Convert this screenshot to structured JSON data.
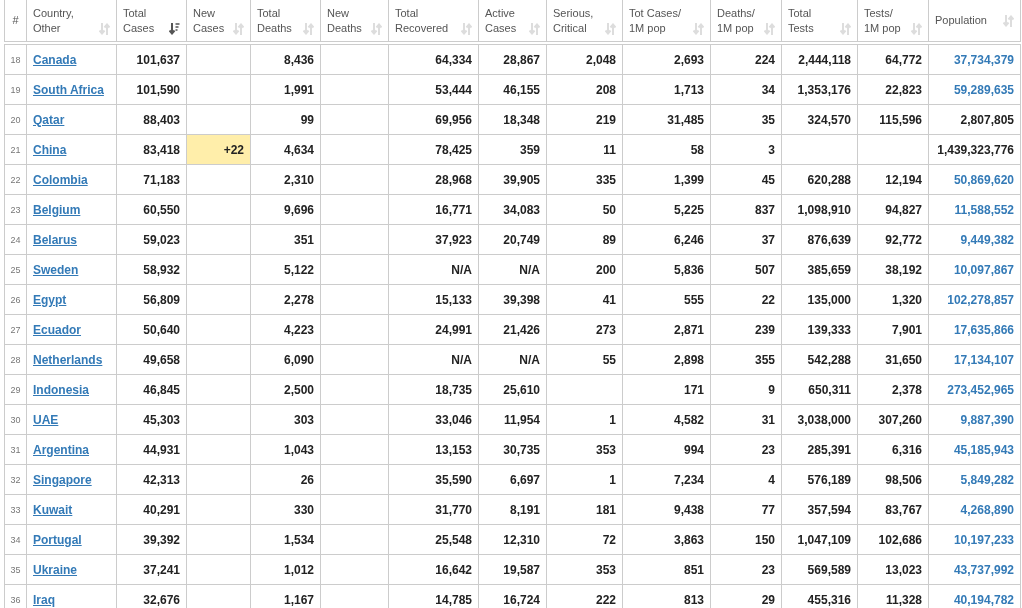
{
  "table": {
    "columns": [
      {
        "lines": [
          "#"
        ]
      },
      {
        "lines": [
          "Country,",
          "Other"
        ],
        "sorted": false
      },
      {
        "lines": [
          "Total",
          "Cases"
        ],
        "sorted": true
      },
      {
        "lines": [
          "New",
          "Cases"
        ],
        "sorted": false
      },
      {
        "lines": [
          "Total",
          "Deaths"
        ],
        "sorted": false
      },
      {
        "lines": [
          "New",
          "Deaths"
        ],
        "sorted": false
      },
      {
        "lines": [
          "Total",
          "Recovered"
        ],
        "sorted": false
      },
      {
        "lines": [
          "Active",
          "Cases"
        ],
        "sorted": false
      },
      {
        "lines": [
          "Serious,",
          "Critical"
        ],
        "sorted": false
      },
      {
        "lines": [
          "Tot Cases/",
          "1M pop"
        ],
        "sorted": false
      },
      {
        "lines": [
          "Deaths/",
          "1M pop"
        ],
        "sorted": false
      },
      {
        "lines": [
          "Total",
          "Tests"
        ],
        "sorted": false
      },
      {
        "lines": [
          "Tests/",
          "1M pop"
        ],
        "sorted": false
      },
      {
        "lines": [
          "Population"
        ],
        "sorted": false
      }
    ],
    "rows": [
      {
        "rank": "18",
        "country": "Canada",
        "total_cases": "101,637",
        "total_deaths": "8,436",
        "total_recovered": "64,334",
        "active_cases": "28,867",
        "serious_critical": "2,048",
        "cases_per_1m": "2,693",
        "deaths_per_1m": "224",
        "total_tests": "2,444,118",
        "tests_per_1m": "64,772",
        "population": "37,734,379",
        "new_highlight": false,
        "population_link": true
      },
      {
        "rank": "19",
        "country": "South Africa",
        "total_cases": "101,590",
        "total_deaths": "1,991",
        "total_recovered": "53,444",
        "active_cases": "46,155",
        "serious_critical": "208",
        "cases_per_1m": "1,713",
        "deaths_per_1m": "34",
        "total_tests": "1,353,176",
        "tests_per_1m": "22,823",
        "population": "59,289,635",
        "new_highlight": false,
        "population_link": true
      },
      {
        "rank": "20",
        "country": "Qatar",
        "total_cases": "88,403",
        "total_deaths": "99",
        "total_recovered": "69,956",
        "active_cases": "18,348",
        "serious_critical": "219",
        "cases_per_1m": "31,485",
        "deaths_per_1m": "35",
        "total_tests": "324,570",
        "tests_per_1m": "115,596",
        "population": "2,807,805",
        "new_highlight": false,
        "population_link": false
      },
      {
        "rank": "21",
        "country": "China",
        "total_cases": "83,418",
        "new_cases": "+22",
        "total_deaths": "4,634",
        "total_recovered": "78,425",
        "active_cases": "359",
        "serious_critical": "11",
        "cases_per_1m": "58",
        "deaths_per_1m": "3",
        "population": "1,439,323,776",
        "new_highlight": true,
        "population_link": false
      },
      {
        "rank": "22",
        "country": "Colombia",
        "total_cases": "71,183",
        "total_deaths": "2,310",
        "total_recovered": "28,968",
        "active_cases": "39,905",
        "serious_critical": "335",
        "cases_per_1m": "1,399",
        "deaths_per_1m": "45",
        "total_tests": "620,288",
        "tests_per_1m": "12,194",
        "population": "50,869,620",
        "new_highlight": false,
        "population_link": true
      },
      {
        "rank": "23",
        "country": "Belgium",
        "total_cases": "60,550",
        "total_deaths": "9,696",
        "total_recovered": "16,771",
        "active_cases": "34,083",
        "serious_critical": "50",
        "cases_per_1m": "5,225",
        "deaths_per_1m": "837",
        "total_tests": "1,098,910",
        "tests_per_1m": "94,827",
        "population": "11,588,552",
        "new_highlight": false,
        "population_link": true
      },
      {
        "rank": "24",
        "country": "Belarus",
        "total_cases": "59,023",
        "total_deaths": "351",
        "total_recovered": "37,923",
        "active_cases": "20,749",
        "serious_critical": "89",
        "cases_per_1m": "6,246",
        "deaths_per_1m": "37",
        "total_tests": "876,639",
        "tests_per_1m": "92,772",
        "population": "9,449,382",
        "new_highlight": false,
        "population_link": true
      },
      {
        "rank": "25",
        "country": "Sweden",
        "total_cases": "58,932",
        "total_deaths": "5,122",
        "total_recovered": "N/A",
        "active_cases": "N/A",
        "serious_critical": "200",
        "cases_per_1m": "5,836",
        "deaths_per_1m": "507",
        "total_tests": "385,659",
        "tests_per_1m": "38,192",
        "population": "10,097,867",
        "new_highlight": false,
        "population_link": true
      },
      {
        "rank": "26",
        "country": "Egypt",
        "total_cases": "56,809",
        "total_deaths": "2,278",
        "total_recovered": "15,133",
        "active_cases": "39,398",
        "serious_critical": "41",
        "cases_per_1m": "555",
        "deaths_per_1m": "22",
        "total_tests": "135,000",
        "tests_per_1m": "1,320",
        "population": "102,278,857",
        "new_highlight": false,
        "population_link": true
      },
      {
        "rank": "27",
        "country": "Ecuador",
        "total_cases": "50,640",
        "total_deaths": "4,223",
        "total_recovered": "24,991",
        "active_cases": "21,426",
        "serious_critical": "273",
        "cases_per_1m": "2,871",
        "deaths_per_1m": "239",
        "total_tests": "139,333",
        "tests_per_1m": "7,901",
        "population": "17,635,866",
        "new_highlight": false,
        "population_link": true
      },
      {
        "rank": "28",
        "country": "Netherlands",
        "total_cases": "49,658",
        "total_deaths": "6,090",
        "total_recovered": "N/A",
        "active_cases": "N/A",
        "serious_critical": "55",
        "cases_per_1m": "2,898",
        "deaths_per_1m": "355",
        "total_tests": "542,288",
        "tests_per_1m": "31,650",
        "population": "17,134,107",
        "new_highlight": false,
        "population_link": true
      },
      {
        "rank": "29",
        "country": "Indonesia",
        "total_cases": "46,845",
        "total_deaths": "2,500",
        "total_recovered": "18,735",
        "active_cases": "25,610",
        "cases_per_1m": "171",
        "deaths_per_1m": "9",
        "total_tests": "650,311",
        "tests_per_1m": "2,378",
        "population": "273,452,965",
        "new_highlight": false,
        "population_link": true
      },
      {
        "rank": "30",
        "country": "UAE",
        "total_cases": "45,303",
        "total_deaths": "303",
        "total_recovered": "33,046",
        "active_cases": "11,954",
        "serious_critical": "1",
        "cases_per_1m": "4,582",
        "deaths_per_1m": "31",
        "total_tests": "3,038,000",
        "tests_per_1m": "307,260",
        "population": "9,887,390",
        "new_highlight": false,
        "population_link": true
      },
      {
        "rank": "31",
        "country": "Argentina",
        "total_cases": "44,931",
        "total_deaths": "1,043",
        "total_recovered": "13,153",
        "active_cases": "30,735",
        "serious_critical": "353",
        "cases_per_1m": "994",
        "deaths_per_1m": "23",
        "total_tests": "285,391",
        "tests_per_1m": "6,316",
        "population": "45,185,943",
        "new_highlight": false,
        "population_link": true
      },
      {
        "rank": "32",
        "country": "Singapore",
        "total_cases": "42,313",
        "total_deaths": "26",
        "total_recovered": "35,590",
        "active_cases": "6,697",
        "serious_critical": "1",
        "cases_per_1m": "7,234",
        "deaths_per_1m": "4",
        "total_tests": "576,189",
        "tests_per_1m": "98,506",
        "population": "5,849,282",
        "new_highlight": false,
        "population_link": true
      },
      {
        "rank": "33",
        "country": "Kuwait",
        "total_cases": "40,291",
        "total_deaths": "330",
        "total_recovered": "31,770",
        "active_cases": "8,191",
        "serious_critical": "181",
        "cases_per_1m": "9,438",
        "deaths_per_1m": "77",
        "total_tests": "357,594",
        "tests_per_1m": "83,767",
        "population": "4,268,890",
        "new_highlight": false,
        "population_link": true
      },
      {
        "rank": "34",
        "country": "Portugal",
        "total_cases": "39,392",
        "total_deaths": "1,534",
        "total_recovered": "25,548",
        "active_cases": "12,310",
        "serious_critical": "72",
        "cases_per_1m": "3,863",
        "deaths_per_1m": "150",
        "total_tests": "1,047,109",
        "tests_per_1m": "102,686",
        "population": "10,197,233",
        "new_highlight": false,
        "population_link": true
      },
      {
        "rank": "35",
        "country": "Ukraine",
        "total_cases": "37,241",
        "total_deaths": "1,012",
        "total_recovered": "16,642",
        "active_cases": "19,587",
        "serious_critical": "353",
        "cases_per_1m": "851",
        "deaths_per_1m": "23",
        "total_tests": "569,589",
        "tests_per_1m": "13,023",
        "population": "43,737,992",
        "new_highlight": false,
        "population_link": true
      },
      {
        "rank": "36",
        "country": "Iraq",
        "total_cases": "32,676",
        "total_deaths": "1,167",
        "total_recovered": "14,785",
        "active_cases": "16,724",
        "serious_critical": "222",
        "cases_per_1m": "813",
        "deaths_per_1m": "29",
        "total_tests": "455,316",
        "tests_per_1m": "11,328",
        "population": "40,194,782",
        "new_highlight": false,
        "population_link": true
      }
    ]
  }
}
